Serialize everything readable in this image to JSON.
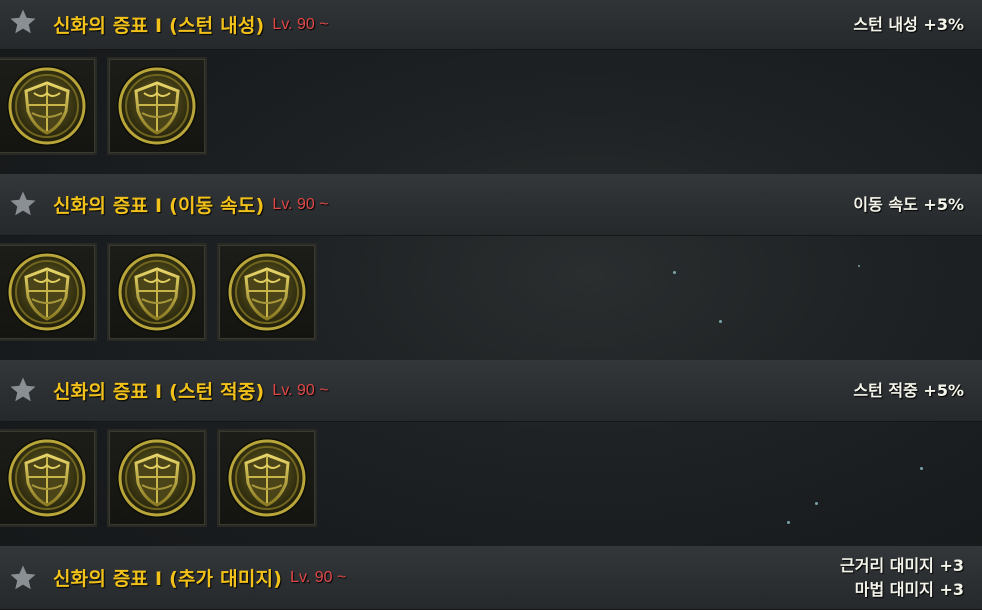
{
  "sets": [
    {
      "title": "신화의 증표 I (스턴 내성)",
      "level": "Lv. 90 ~",
      "effects": [
        "스턴 내성 +3%"
      ],
      "items": [
        {
          "icon": "shield-emblem-icon"
        },
        {
          "icon": "shield-emblem-icon"
        }
      ]
    },
    {
      "title": "신화의 증표 I (이동 속도)",
      "level": "Lv. 90 ~",
      "effects": [
        "이동 속도 +5%"
      ],
      "items": [
        {
          "icon": "shield-emblem-icon"
        },
        {
          "icon": "shield-emblem-icon"
        },
        {
          "icon": "shield-emblem-icon"
        }
      ]
    },
    {
      "title": "신화의 증표 I (스턴 적중)",
      "level": "Lv. 90 ~",
      "effects": [
        "스턴 적중 +5%"
      ],
      "items": [
        {
          "icon": "shield-emblem-icon"
        },
        {
          "icon": "shield-emblem-icon"
        },
        {
          "icon": "shield-emblem-icon"
        }
      ]
    },
    {
      "title": "신화의 증표 I (추가 대미지)",
      "level": "Lv. 90 ~",
      "effects": [
        "근거리 대미지 +3",
        "마법 대미지 +3"
      ],
      "items": []
    }
  ],
  "colors": {
    "title": "#f2c21a",
    "level": "#e04848",
    "effect": "#f4f4ea",
    "star": "#8a8f93"
  }
}
